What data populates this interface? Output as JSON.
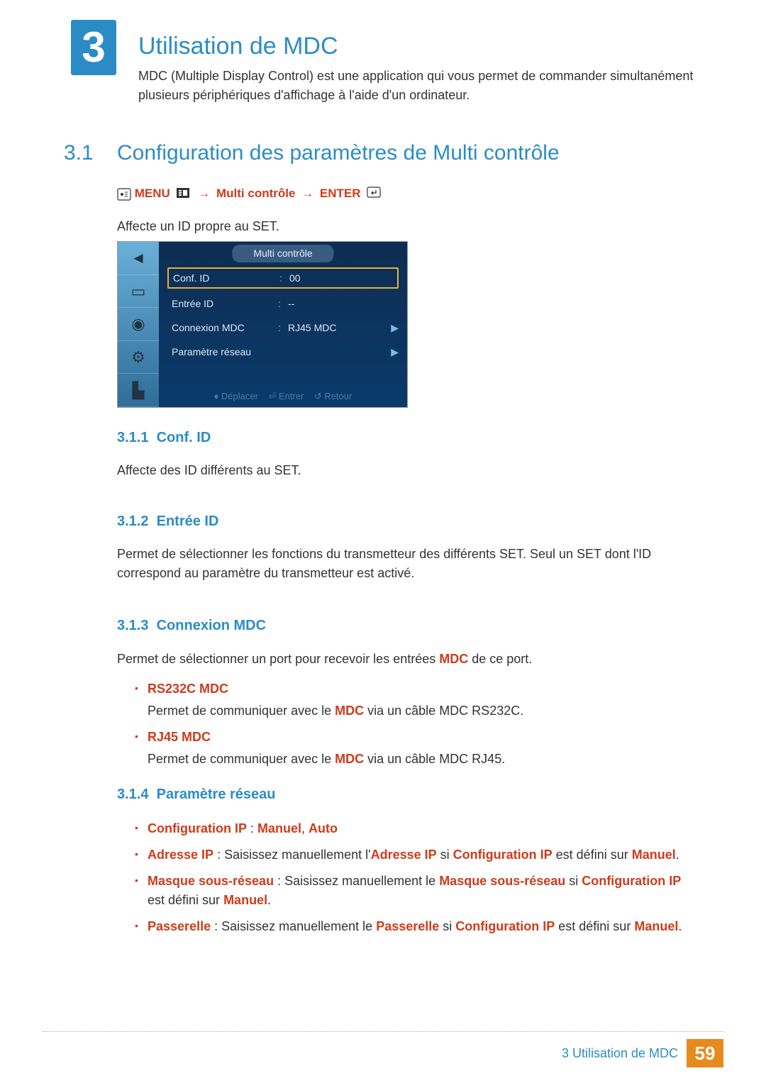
{
  "chapter": {
    "number": "3",
    "title": "Utilisation de MDC"
  },
  "intro": "MDC (Multiple Display Control) est une application qui vous permet de commander simultanément plusieurs périphériques d'affichage à l'aide d'un ordinateur.",
  "section": {
    "number": "3.1",
    "title": "Configuration des paramètres de Multi contrôle"
  },
  "breadcrumb": {
    "menu": "MENU",
    "arrow": "→",
    "item": "Multi contrôle",
    "enter": "ENTER"
  },
  "affecte_set": "Affecte un ID propre au SET.",
  "osd": {
    "title": "Multi contrôle",
    "rows": [
      {
        "label": "Conf. ID",
        "colon": ":",
        "value": "00",
        "arrow": ""
      },
      {
        "label": "Entrée ID",
        "colon": ":",
        "value": "--",
        "arrow": ""
      },
      {
        "label": "Connexion MDC",
        "colon": ":",
        "value": "RJ45 MDC",
        "arrow": "▶"
      },
      {
        "label": "Paramètre réseau",
        "colon": "",
        "value": "",
        "arrow": "▶"
      }
    ],
    "footer": {
      "move": "Déplacer",
      "enter": "Entrer",
      "return": "Retour"
    }
  },
  "sub": {
    "confid": {
      "num": "3.1.1",
      "title": "Conf. ID",
      "text": "Affecte des ID différents au SET."
    },
    "entreeid": {
      "num": "3.1.2",
      "title": "Entrée ID",
      "text": "Permet de sélectionner les fonctions du transmetteur des différents SET. Seul un SET dont l'ID correspond au paramètre du transmetteur est activé."
    },
    "conn": {
      "num": "3.1.3",
      "title": "Connexion MDC",
      "lead_a": "Permet de sélectionner un port pour recevoir les entrées ",
      "lead_b": "MDC",
      "lead_c": " de ce port.",
      "items": [
        {
          "head": "RS232C MDC",
          "desc_a": "Permet de communiquer avec le ",
          "desc_b": "MDC",
          "desc_c": " via un câble MDC RS232C."
        },
        {
          "head": "RJ45 MDC",
          "desc_a": "Permet de communiquer avec le ",
          "desc_b": "MDC",
          "desc_c": " via un câble MDC RJ45."
        }
      ]
    },
    "reseau": {
      "num": "3.1.4",
      "title": "Paramètre réseau",
      "items": {
        "cfgip": {
          "label": "Configuration IP",
          "sep": " : ",
          "v1": "Manuel",
          "comma": ", ",
          "v2": "Auto"
        },
        "adresse": {
          "label": "Adresse IP",
          "a": " : Saisissez manuellement l'",
          "b": "Adresse IP",
          "c": " si ",
          "d": "Configuration IP",
          "e": " est défini sur ",
          "f": "Manuel",
          "g": "."
        },
        "masque": {
          "label": "Masque sous-réseau",
          "a": " : Saisissez manuellement le ",
          "b": "Masque sous-réseau",
          "c": " si ",
          "d": "Configuration IP",
          "e": " est défini sur ",
          "f": "Manuel",
          "g": "."
        },
        "passerelle": {
          "label": "Passerelle",
          "a": " : Saisissez manuellement le ",
          "b": "Passerelle",
          "c": " si ",
          "d": "Configuration IP",
          "e": " est défini sur ",
          "f": "Manuel",
          "g": "."
        }
      }
    }
  },
  "footer": {
    "text": "3 Utilisation de MDC",
    "page": "59"
  }
}
